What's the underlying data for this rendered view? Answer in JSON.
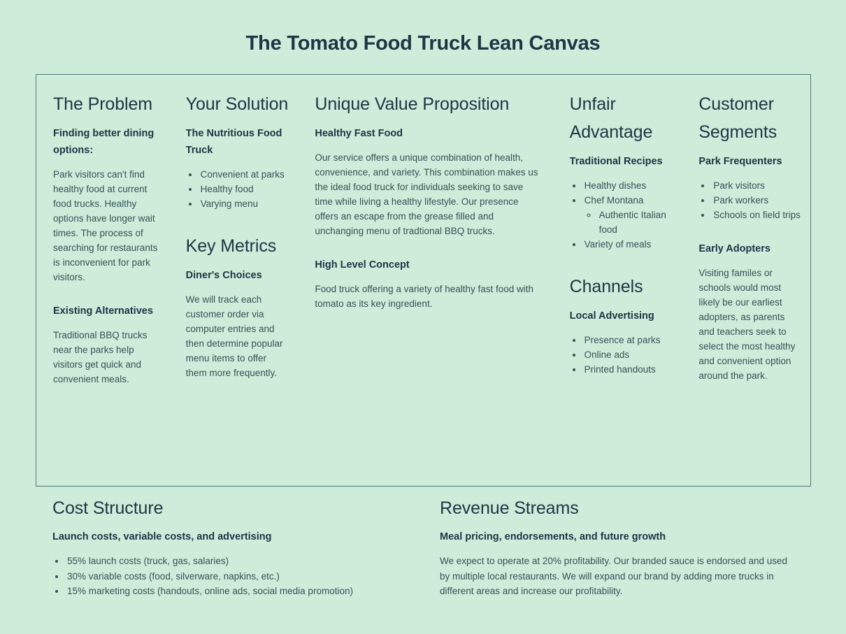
{
  "document": {
    "title": "The Tomato Food Truck Lean Canvas",
    "colors": {
      "background": "#cdecd9",
      "heading": "#1d3545",
      "body_text": "#335359",
      "border": "#4d7a78"
    }
  },
  "canvas": {
    "problem": {
      "title": "The Problem",
      "subtitle": "Finding better dining options:",
      "body": "Park visitors can't find healthy food at current food trucks. Healthy options have longer wait times. The process of searching for restaurants is inconvenient for park visitors.",
      "alternatives_title": "Existing Alternatives",
      "alternatives_body": "Traditional BBQ trucks near the parks help visitors get quick and convenient meals."
    },
    "solution": {
      "title": "Your Solution",
      "subtitle": "The Nutritious Food Truck",
      "bullets": [
        "Convenient at parks",
        "Healthy food",
        "Varying menu"
      ]
    },
    "key_metrics": {
      "title": "Key Metrics",
      "subtitle": "Diner's Choices",
      "body": "We will track each customer order via computer entries and then determine popular menu items to offer them more frequently."
    },
    "uvp": {
      "title": "Unique Value Proposition",
      "subtitle": "Healthy Fast Food",
      "body": "Our service offers a unique combination of health, convenience, and variety. This combination makes us the ideal food truck for individuals seeking to save time while living a healthy lifestyle. Our presence offers an escape from the grease filled and unchanging menu of tradtional BBQ trucks.",
      "concept_title": "High Level Concept",
      "concept_body": "Food truck offering a variety of healthy fast food with tomato as its key ingredient."
    },
    "unfair_advantage": {
      "title": "Unfair Advantage",
      "subtitle": "Traditional Recipes",
      "bullets": [
        "Healthy dishes",
        "Chef Montana",
        "Variety of meals"
      ],
      "sub_bullet": "Authentic Italian food"
    },
    "channels": {
      "title": "Channels",
      "subtitle": "Local Advertising",
      "bullets": [
        "Presence at parks",
        "Online ads",
        "Printed handouts"
      ]
    },
    "customer_segments": {
      "title": "Customer Segments",
      "subtitle": "Park Frequenters",
      "bullets": [
        "Park visitors",
        "Park workers",
        "Schools on field trips"
      ],
      "early_adopters_title": "Early Adopters",
      "early_adopters_body": "Visiting familes or schools would most likely be our earliest adopters, as parents and teachers seek to select the most healthy and convenient option around the park."
    }
  },
  "bottom": {
    "cost_structure": {
      "title": "Cost Structure",
      "subtitle": "Launch costs, variable costs, and advertising",
      "bullets": [
        "55% launch costs (truck, gas, salaries)",
        "30% variable costs (food, silverware, napkins, etc.)",
        "15% marketing costs (handouts, online ads, social media promotion)"
      ]
    },
    "revenue_streams": {
      "title": "Revenue Streams",
      "subtitle": "Meal pricing, endorsements, and future growth",
      "body": "We expect to operate at 20% profitability. Our branded sauce is endorsed and used by multiple local restaurants. We will expand our brand by adding more trucks in different areas and increase our profitability."
    }
  }
}
